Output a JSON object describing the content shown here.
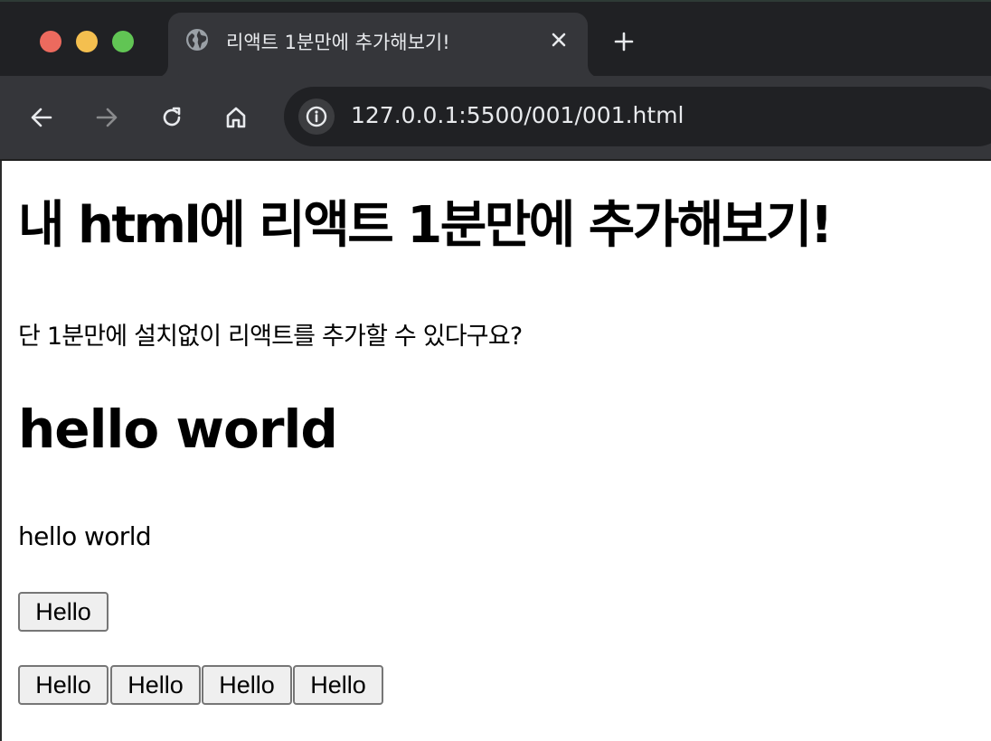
{
  "browser": {
    "tab": {
      "title": "리액트 1분만에 추가해보기!",
      "icon": "globe-icon"
    },
    "toolbar": {
      "url": "127.0.0.1:5500/001/001.html",
      "icons": [
        "back-arrow-icon",
        "forward-arrow-icon",
        "reload-icon",
        "home-icon",
        "info-icon"
      ]
    },
    "colors": {
      "tabbar_bg": "#202124",
      "toolbar_bg": "#35363a",
      "omnibox_bg": "#202124",
      "traffic_red": "#ec6a5e",
      "traffic_yellow": "#f4bf4f",
      "traffic_green": "#61c554"
    }
  },
  "page": {
    "heading": "내 html에 리액트 1분만에 추가해보기!",
    "description": "단 1분만에 설치없이 리액트를 추가할 수 있다구요?",
    "hello_heading": "hello world",
    "hello_paragraph": "hello world",
    "single_button_label": "Hello",
    "button_row": [
      {
        "label": "Hello"
      },
      {
        "label": "Hello"
      },
      {
        "label": "Hello"
      },
      {
        "label": "Hello"
      }
    ]
  }
}
